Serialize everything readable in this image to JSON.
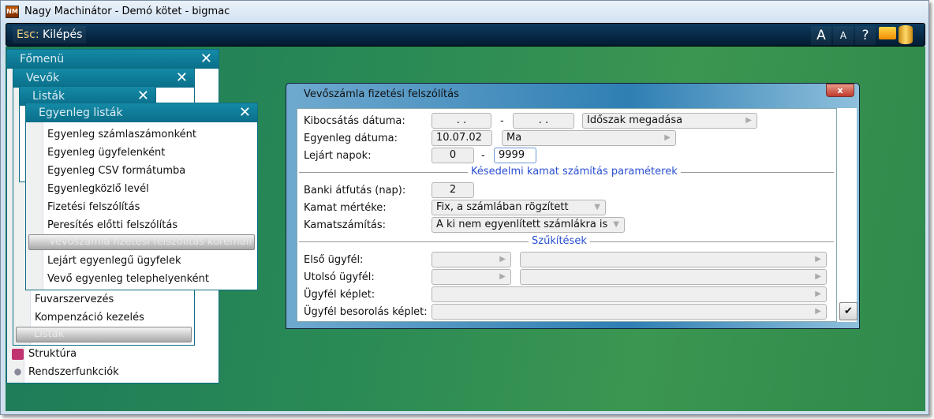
{
  "window": {
    "title": "Nagy Machinátor - Demó kötet - bigmac",
    "icon": "NM"
  },
  "toolbar": {
    "esc_key": "Esc:",
    "esc_label": "Kilépés",
    "font_large": "A",
    "font_small": "A",
    "help": "?"
  },
  "menus": {
    "fomenu": {
      "title": "Főmenü",
      "items": [
        "Struktúra",
        "Rendszerfunkciók"
      ]
    },
    "vevok": {
      "title": "Vevők",
      "items": [
        "Fuvarszervezés",
        "Kompenzáció kezelés"
      ],
      "selected": "Listák"
    },
    "listak": {
      "title": "Listák"
    },
    "egyenleg": {
      "title": "Egyenleg listák",
      "items": [
        "Egyenleg számlaszámonként",
        "Egyenleg ügyfelenként",
        "Egyenleg CSV formátumba",
        "Egyenlegközlő levél",
        "Fizetési felszólítás",
        "Peresítés előtti felszólítás",
        "Vevőszámla fizetési felszólítás köremail",
        "Lejárt egyenlegű ügyfelek",
        "Vevő egyenleg telephelyenként"
      ],
      "selected_index": 6
    }
  },
  "dialog": {
    "title": "Vevőszámla fizetési felszólítás",
    "close": "x",
    "kibocsatas": {
      "label": "Kibocsátás dátuma:",
      "from": ". .",
      "to": ". .",
      "dash": "-",
      "period": "Időszak megadása"
    },
    "egyenleg": {
      "label": "Egyenleg dátuma:",
      "value": "10.07.02",
      "preset": "Ma"
    },
    "lejart": {
      "label": "Lejárt napok:",
      "from": "0",
      "dash": "-",
      "to": "9999"
    },
    "section1": "Késedelmi kamat számítás paraméterek",
    "banki": {
      "label": "Banki átfutás (nap):",
      "value": "2"
    },
    "kamat_mertek": {
      "label": "Kamat mértéke:",
      "value": "Fix, a számlában rögzített"
    },
    "kamatszamitas": {
      "label": "Kamatszámítás:",
      "value": "A ki nem egyenlített számlákra is"
    },
    "section2": "Szűkítések",
    "elso": {
      "label": "Első ügyfél:"
    },
    "utolso": {
      "label": "Utolsó ügyfél:"
    },
    "ugyfel_keplet": {
      "label": "Ügyfél képlet:"
    },
    "besorolas_keplet": {
      "label": "Ügyfél besorolás képlet:"
    },
    "ok": "✔"
  }
}
